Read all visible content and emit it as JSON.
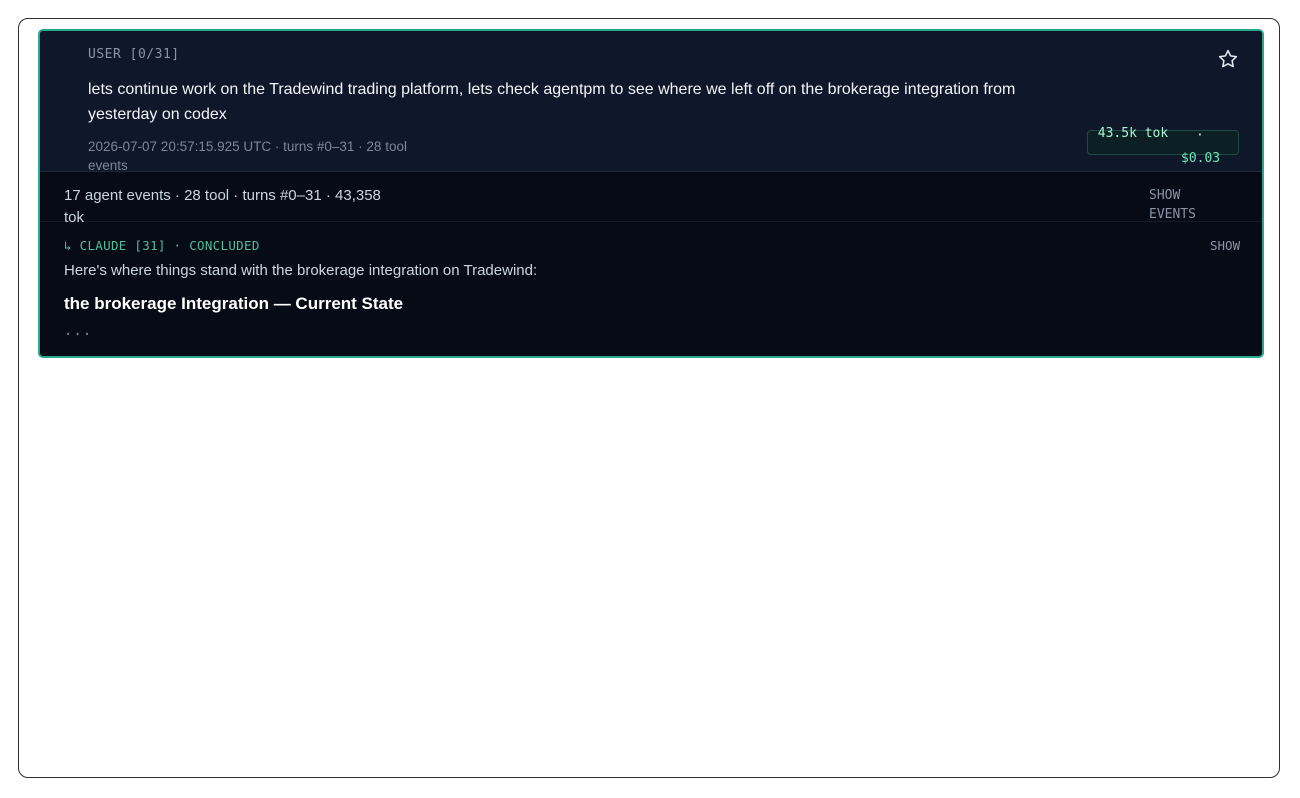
{
  "user_message": {
    "role_label": "USER [0/31]",
    "text": "lets continue work on the Tradewind trading platform, lets check agentpm to see where we left off on the brokerage integration from yesterday on codex",
    "meta": "2026-07-07 20:57:15.925 UTC · turns #0–31 · 28 tool events",
    "star_icon": "star-outline-icon"
  },
  "token_badge": {
    "tokens": "43.5k tok",
    "separator": "·",
    "cost": "$0.03"
  },
  "summary": {
    "text": "17 agent events · 28 tool · turns #0–31 · 43,358 tok",
    "show_events_label": "SHOW EVENTS"
  },
  "claude_reply": {
    "header": "↳ CLAUDE [31] · CONCLUDED",
    "show_label": "SHOW",
    "intro": "Here's where things stand with the brokerage integration on Tradewind:",
    "heading": "the brokerage Integration — Current State",
    "ellipsis": "..."
  },
  "colors": {
    "card_border": "#2aa889",
    "card_bg": "#060b16",
    "user_bg": "#0f172a",
    "accent_green": "#4fbf9c"
  }
}
